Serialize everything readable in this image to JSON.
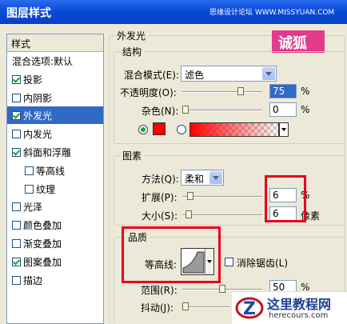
{
  "window": {
    "title": "图层样式",
    "watermark": "思缘设计论坛 WWW.MISSYUAN.COM"
  },
  "sidebar": {
    "header": "样式",
    "items": [
      {
        "label": "混合选项:默认",
        "checkbox": false
      },
      {
        "label": "投影",
        "checkbox": true,
        "checked": true
      },
      {
        "label": "内阴影",
        "checkbox": true,
        "checked": false
      },
      {
        "label": "外发光",
        "checkbox": true,
        "checked": true,
        "selected": true
      },
      {
        "label": "内发光",
        "checkbox": true,
        "checked": false
      },
      {
        "label": "斜面和浮雕",
        "checkbox": true,
        "checked": true
      },
      {
        "label": "等高线",
        "checkbox": true,
        "checked": false,
        "indent": true
      },
      {
        "label": "纹理",
        "checkbox": true,
        "checked": false,
        "indent": true
      },
      {
        "label": "光泽",
        "checkbox": true,
        "checked": false
      },
      {
        "label": "颜色叠加",
        "checkbox": true,
        "checked": false
      },
      {
        "label": "渐变叠加",
        "checkbox": true,
        "checked": false
      },
      {
        "label": "图案叠加",
        "checkbox": true,
        "checked": true
      },
      {
        "label": "描边",
        "checkbox": true,
        "checked": false
      }
    ]
  },
  "panel": {
    "title": "外发光",
    "logo_text": "诚狐",
    "structure": {
      "title": "结构",
      "blend_mode_label": "混合模式(E):",
      "blend_mode_value": "滤色",
      "opacity_label": "不透明度(O):",
      "opacity_value": "75",
      "opacity_unit": "%",
      "opacity_level": 0.75,
      "noise_label": "杂色(N):",
      "noise_value": "0",
      "noise_unit": "%",
      "noise_level": 0,
      "color": "#ff0000"
    },
    "elements": {
      "title": "图素",
      "method_label": "方法(Q):",
      "method_value": "柔和",
      "spread_label": "扩展(P):",
      "spread_value": "6",
      "spread_unit": "%",
      "spread_level": 0.06,
      "size_label": "大小(S):",
      "size_value": "6",
      "size_unit": "像素"
    },
    "quality": {
      "title": "品质",
      "contour_label": "等高线:",
      "antialias_label": "消除锯齿(L)",
      "range_label": "范围(R):",
      "range_value": "50",
      "range_unit": "%",
      "jitter_label": "抖动(J):"
    }
  },
  "site_logo": {
    "name": "这里教程网",
    "url_text": "herecours.com"
  },
  "colors": {
    "titlebar": "#0a4ad8",
    "highlight": "#316ac5",
    "red_box": "#e8001c",
    "logo_pink": "#e33b8c"
  }
}
